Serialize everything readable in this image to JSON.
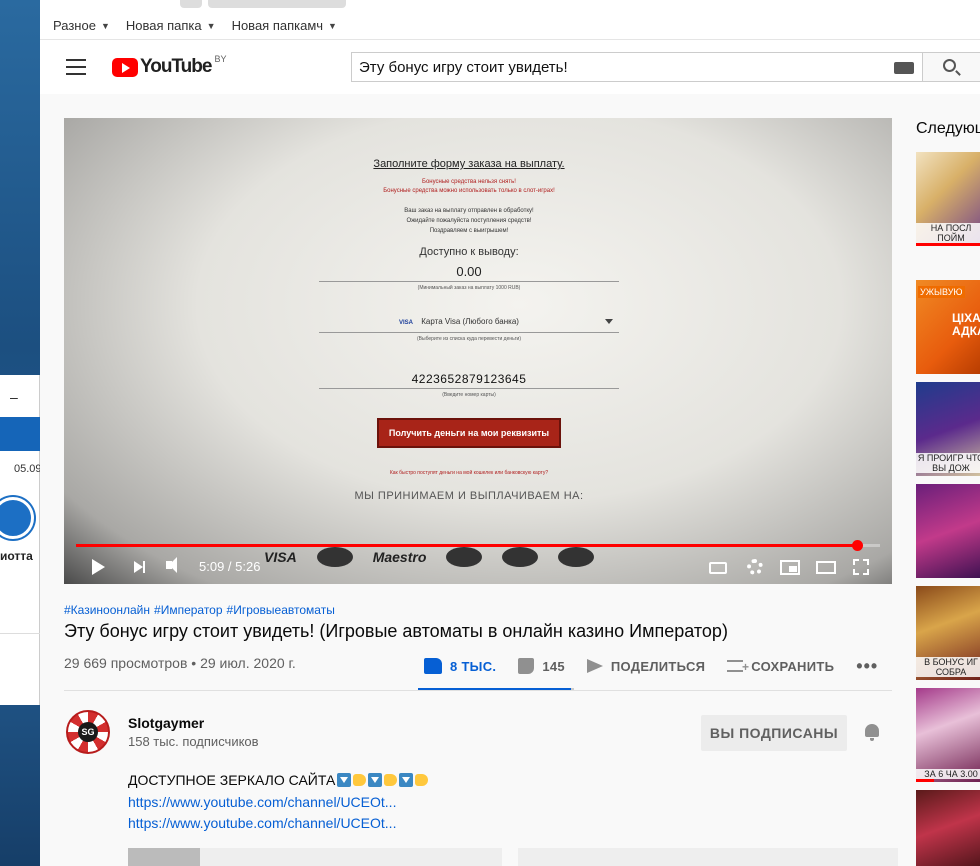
{
  "desktop": {
    "back_window": {
      "minimize_label": "–",
      "date_text": "05.09",
      "text": "иотта"
    }
  },
  "bookmarks": [
    {
      "label": "Разное"
    },
    {
      "label": "Новая папка"
    },
    {
      "label": "Новая папкамч"
    }
  ],
  "header": {
    "logo_text": "YouTube",
    "region": "BY",
    "search_value": "Эту бонус игру стоит увидеть!"
  },
  "player": {
    "time_current": "5:09",
    "time_total": "5:26",
    "time_display": "5:09 / 5:26",
    "progress_fraction": 0.972,
    "loaded_fraction": 1.0,
    "frame": {
      "title": "Заполните форму заказа на выплату.",
      "red_line1": "Бонусные средства нельзя снять!",
      "red_line2": "Бонусные средства можно использовать только в слот-играх!",
      "info_line1": "Ваш заказ на выплату отправлен в обработку!",
      "info_line2": "Ожидайте пожалуйста поступления средств!",
      "info_line3": "Поздравляем с выигрышем!",
      "available_label": "Доступно к выводу:",
      "amount": "0.00",
      "min_hint": "(Минимальный заказ на выплату 1000 RUB)",
      "card_brand": "VISA",
      "card_label": "Карта Visa (Любого банка)",
      "card_hint": "(Выберите из списка куда перевести деньги)",
      "card_number": "4223652879123645",
      "card_number_hint": "(Введите номер карты)",
      "button": "Получить деньги на мои реквизиты",
      "link": "Как быстро поступят деньги на мой кошелек или банковскую карту?",
      "accept": "МЫ ПРИНИМАЕМ И ВЫПЛАЧИВАЕМ НА:",
      "pay_visa": "VISA",
      "pay_maestro": "Maestro"
    }
  },
  "video": {
    "tags": [
      "#Казиноонлайн",
      "#Император",
      "#Игровыеавтоматы"
    ],
    "title": "Эту бонус игру стоит увидеть! (Игровые автоматы в онлайн казино Император)",
    "stats": "29 669 просмотров • 29 июл. 2020 г.",
    "likes": "8 ТЫС.",
    "dislikes": "145",
    "share_label": "ПОДЕЛИТЬСЯ",
    "save_label": "СОХРАНИТЬ",
    "more_label": "•••",
    "like_ratio": 0.98
  },
  "channel": {
    "avatar_text": "SG",
    "name": "Slotgaymer",
    "subscribers": "158 тыс. подписчиков",
    "subscribe_label": "ВЫ ПОДПИСАНЫ"
  },
  "description": {
    "line1": "ДОСТУПНОЕ ЗЕРКАЛО САЙТА",
    "link1": "https://www.youtube.com/channel/UCEOt...",
    "link2": "https://www.youtube.com/channel/UCEOt..."
  },
  "sidebar": {
    "next_label": "Следующ",
    "items": [
      {
        "caption": "НА ПОСЛ ПОЙМ"
      },
      {
        "badge": "УЖЫВУЮ",
        "caption": "ЦІХА АДКА"
      },
      {
        "caption": "Я ПРОИГР ЧТО ВЫ ДОЖ"
      },
      {
        "caption": ""
      },
      {
        "caption": "В БОНУС ИГ СОБРА"
      },
      {
        "caption": "ЗА 6 ЧА 3.00"
      },
      {
        "caption": ""
      }
    ]
  },
  "colors": {
    "accent_blue": "#065fd4",
    "youtube_red": "#ff0000",
    "payout_button": "#a82418"
  }
}
